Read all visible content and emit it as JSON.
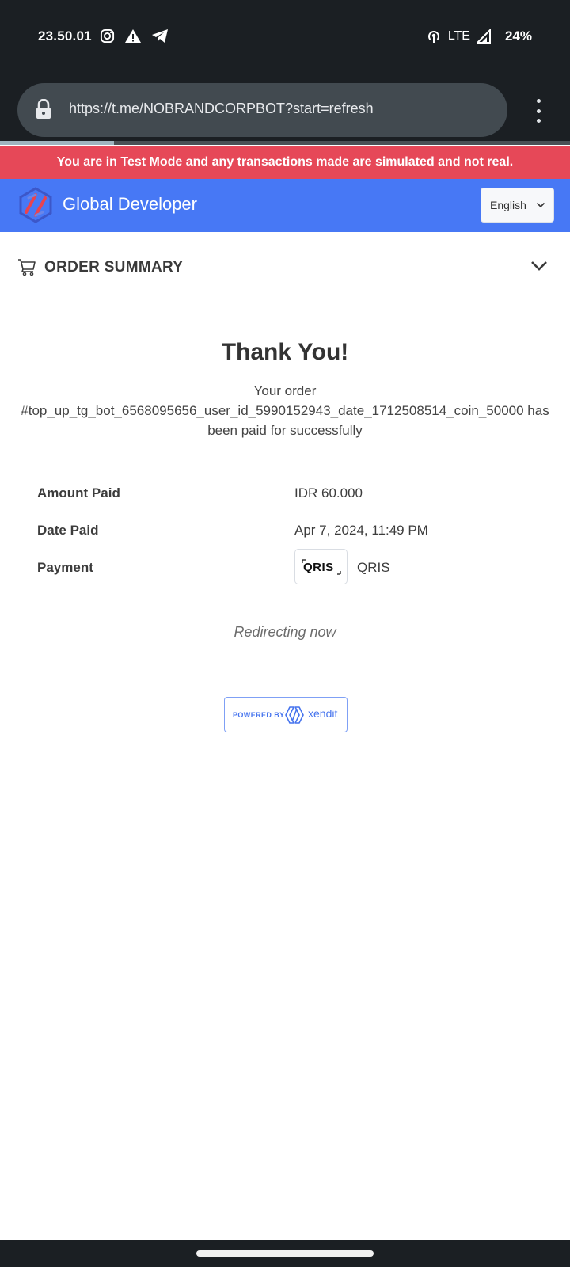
{
  "status_bar": {
    "time": "23.50.01",
    "network": "LTE",
    "battery": "24%",
    "icons": [
      "instagram-icon",
      "warning-icon",
      "telegram-icon",
      "hotspot-icon",
      "signal-icon"
    ]
  },
  "browser": {
    "url": "https://t.me/NOBRANDCORPBOT?start=refresh",
    "load_progress": 0.2
  },
  "banner": {
    "text": "You are in Test Mode and any transactions made are simulated and not real.",
    "color": "#e64858"
  },
  "header": {
    "brand": "Global Developer",
    "language": "English",
    "color": "#4778f5"
  },
  "order_summary": {
    "label": "ORDER SUMMARY"
  },
  "main": {
    "title": "Thank You!",
    "message_prefix": "Your order",
    "order_id": "#top_up_tg_bot_6568095656_user_id_5990152943_date_1712508514_coin_50000",
    "message_suffix": "has been paid for successfully",
    "details": {
      "amount_label": "Amount Paid",
      "amount_value": "IDR 60.000",
      "date_label": "Date Paid",
      "date_value": "Apr 7, 2024, 11:49 PM",
      "payment_label": "Payment",
      "payment_value": "QRIS",
      "payment_logo_text": "QRIS"
    },
    "redirect_text": "Redirecting now"
  },
  "footer": {
    "powered_by": "POWERED BY",
    "provider": "xendit"
  }
}
